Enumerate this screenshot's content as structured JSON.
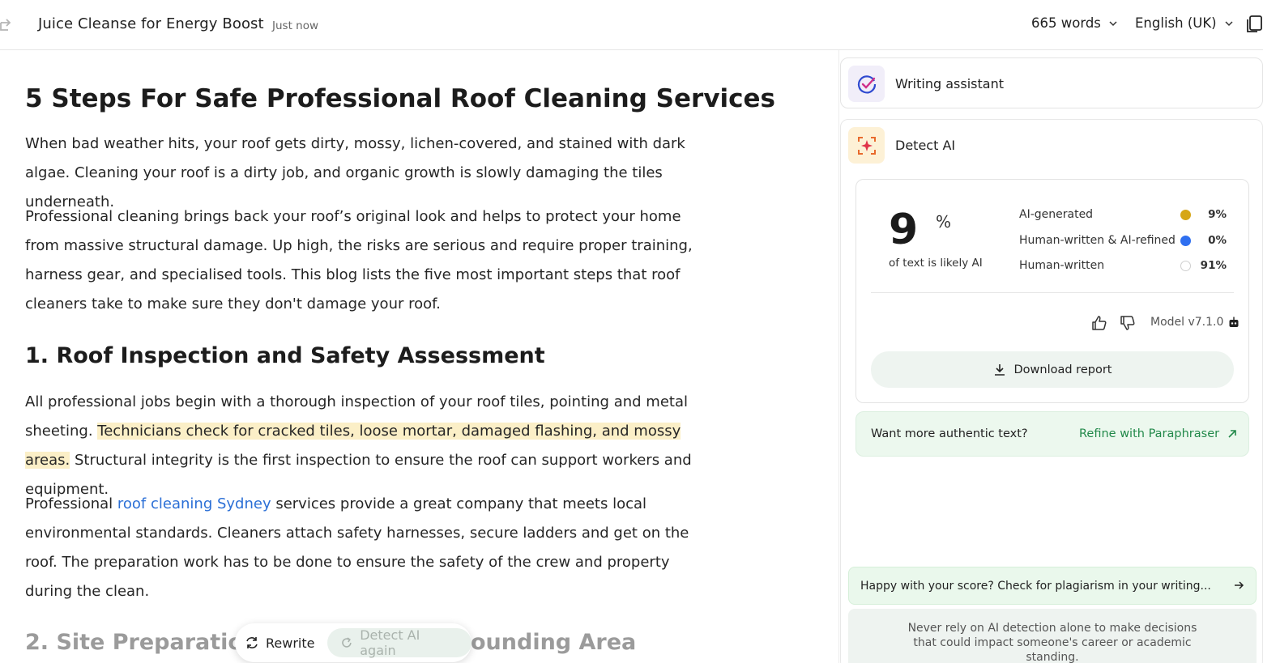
{
  "topbar": {
    "title": "Juice Cleanse for Energy Boost",
    "saved_status": "Just now",
    "word_count": "665 words",
    "language": "English (UK)"
  },
  "article": {
    "h1": "5 Steps For Safe Professional Roof Cleaning Services",
    "p1": "When bad weather hits, your roof gets dirty, mossy, lichen-covered, and stained with dark algae. Cleaning your roof is a dirty job, and organic growth is slowly damaging the tiles underneath.",
    "p2": "Professional cleaning brings back your roof’s original look and helps to protect your home from massive structural damage. Up high, the risks are serious and require proper training, harness gear, and specialised tools. This blog lists the five most important steps that roof cleaners take to make sure they don't damage your roof.",
    "h2_1": "1. Roof Inspection and Safety Assessment",
    "p3_a": "All professional jobs begin with a thorough inspection of your roof tiles, pointing and metal sheeting. ",
    "p3_highlight": "Technicians check for cracked tiles, loose mortar, damaged flashing, and mossy areas.",
    "p3_b": " Structural integrity is the first inspection to ensure the roof can support workers and equipment.",
    "p4_a": "Professional ",
    "p4_link": "roof cleaning Sydney",
    "p4_b": " services provide a great company that meets local environmental standards. Cleaners attach safety harnesses, secure ladders and get on the roof. The preparation work has to be done to ensure the safety of the crew and property during the clean.",
    "h2_2_start": "2. Site Preparation a",
    "h2_2_end": "ounding Area"
  },
  "floating_toolbar": {
    "rewrite": "Rewrite",
    "detect_again": "Detect AI again"
  },
  "sidebar": {
    "writing_assistant": "Writing assistant",
    "detect_ai": "Detect AI",
    "score": {
      "value": "9",
      "unit": "%",
      "caption": "of text is likely AI"
    },
    "breakdown": [
      {
        "label": "AI-generated",
        "value": "9%",
        "color": "#d6a615"
      },
      {
        "label": "Human-written & AI-refined",
        "value": "0%",
        "color": "#2f6ff0"
      },
      {
        "label": "Human-written",
        "value": "91%",
        "color": "#ffffff"
      }
    ],
    "model_version": "Model v7.1.0",
    "download_report": "Download report",
    "refine_question": "Want more authentic text?",
    "refine_link": "Refine with Paraphraser",
    "plagiarism_prompt": "Happy with your score? Check for plagiarism in your writing...",
    "disclaimer": "Never rely on AI detection alone to make decisions that could impact someone's career or academic standing."
  },
  "colors": {
    "accent_green": "#22894a",
    "highlight": "#fbefc7",
    "link": "#2b6fd6"
  }
}
